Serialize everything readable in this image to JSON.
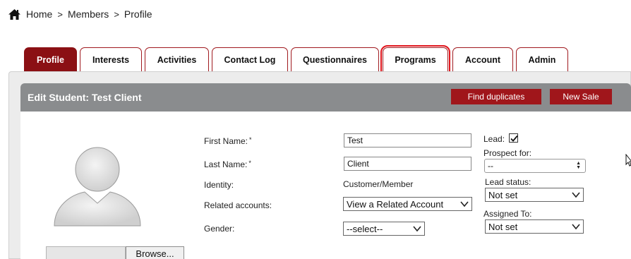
{
  "breadcrumb": {
    "icon": "home-icon",
    "items": [
      "Home",
      "Members",
      "Profile"
    ],
    "separator": ">"
  },
  "tabs": [
    {
      "label": "Profile",
      "active": true
    },
    {
      "label": "Interests"
    },
    {
      "label": "Activities"
    },
    {
      "label": "Contact Log"
    },
    {
      "label": "Questionnaires"
    },
    {
      "label": "Programs",
      "highlighted": true
    },
    {
      "label": "Account"
    },
    {
      "label": "Admin"
    }
  ],
  "header": {
    "title": "Edit Student: Test Client",
    "find_duplicates_label": "Find duplicates",
    "new_sale_label": "New Sale"
  },
  "form": {
    "first_name_label": "First Name:",
    "first_name_value": "Test",
    "last_name_label": "Last Name:",
    "last_name_value": "Client",
    "required_marker": "*",
    "identity_label": "Identity:",
    "identity_value": "Customer/Member",
    "related_accounts_label": "Related accounts:",
    "related_accounts_value": "View a Related Account",
    "gender_label": "Gender:",
    "gender_value": "--select--"
  },
  "side": {
    "lead_label": "Lead:",
    "lead_checked": true,
    "prospect_for_label": "Prospect for:",
    "prospect_for_value": "--",
    "lead_status_label": "Lead status:",
    "lead_status_value": "Not set",
    "assigned_to_label": "Assigned To:",
    "assigned_to_value": "Not set"
  },
  "photo": {
    "browse_label": "Browse..."
  },
  "colors": {
    "accent": "#8b1014",
    "button": "#a0161b",
    "header_bg": "#8a8c8e",
    "highlight": "#e0141b"
  }
}
